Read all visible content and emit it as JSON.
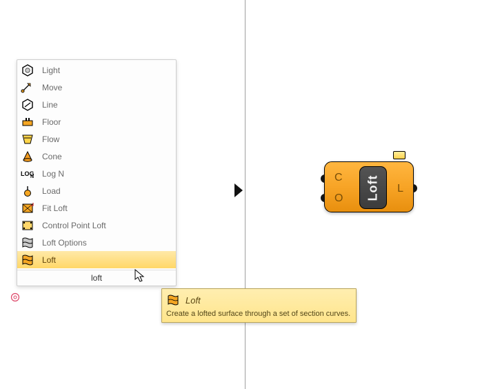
{
  "search": {
    "value": "loft",
    "items": [
      {
        "label": "Light",
        "icon": "hex-light"
      },
      {
        "label": "Move",
        "icon": "move"
      },
      {
        "label": "Line",
        "icon": "hex-line"
      },
      {
        "label": "Floor",
        "icon": "floor"
      },
      {
        "label": "Flow",
        "icon": "flow"
      },
      {
        "label": "Cone",
        "icon": "cone"
      },
      {
        "label": "Log N",
        "icon": "logn"
      },
      {
        "label": "Load",
        "icon": "load"
      },
      {
        "label": "Fit Loft",
        "icon": "fitloft"
      },
      {
        "label": "Control Point Loft",
        "icon": "cploft"
      },
      {
        "label": "Loft Options",
        "icon": "loftopt"
      },
      {
        "label": "Loft",
        "icon": "loft",
        "selected": true
      }
    ]
  },
  "tooltip": {
    "title": "Loft",
    "body": "Create a lofted surface through a set of section curves."
  },
  "component": {
    "name": "Loft",
    "inputs": [
      {
        "label": "C"
      },
      {
        "label": "O"
      }
    ],
    "outputs": [
      {
        "label": "L"
      }
    ]
  }
}
